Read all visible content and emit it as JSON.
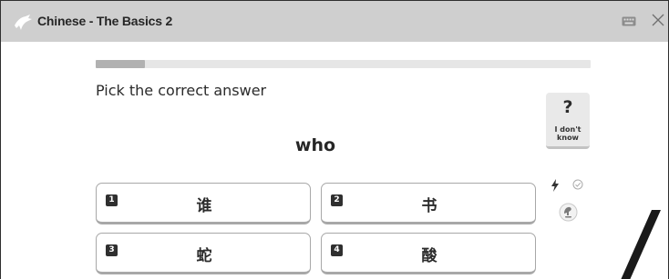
{
  "window": {
    "title": "Chinese - The Basics 2"
  },
  "lesson": {
    "progress_fraction": 0.1,
    "prompt": "Pick the correct answer",
    "word": "who"
  },
  "dont_know": {
    "symbol": "?",
    "label": "I don't know"
  },
  "answers": [
    {
      "number": "1",
      "text": "谁"
    },
    {
      "number": "2",
      "text": "书"
    },
    {
      "number": "3",
      "text": "蛇"
    },
    {
      "number": "4",
      "text": "酸"
    }
  ],
  "icons": {
    "logo": "dragon-logo-icon",
    "keyboard": "keyboard-icon",
    "close": "close-icon",
    "speed": "lightning-icon",
    "check": "checkmark-circle-icon",
    "audio": "speaker-icon"
  },
  "colors": {
    "titlebar": "#cfcfcf",
    "progress_track": "#e6e6e6",
    "progress_fill": "#b1b1b1",
    "number_badge": "#2f2f2f"
  }
}
